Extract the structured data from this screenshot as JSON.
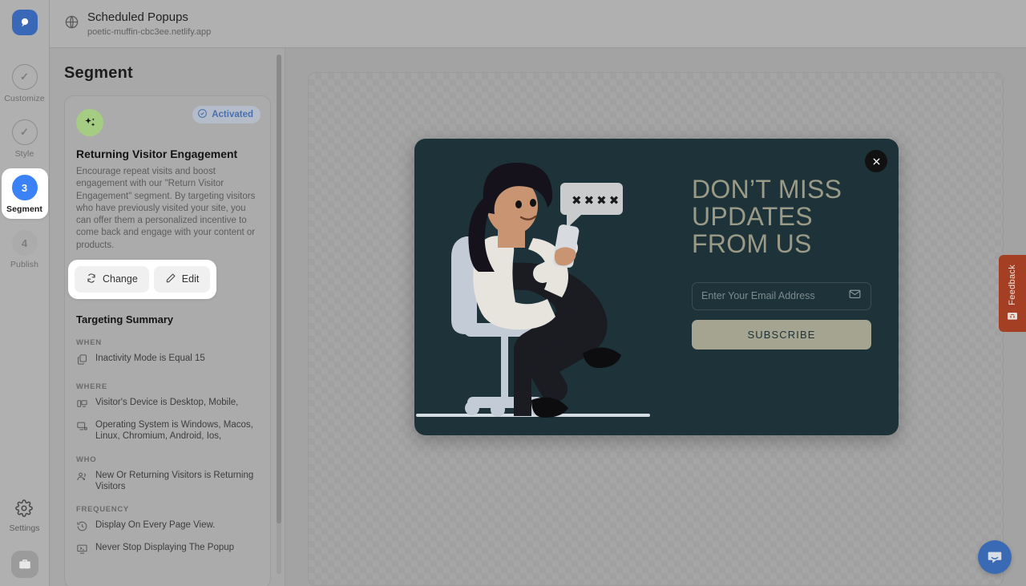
{
  "topbar": {
    "globe_icon": "globe-icon",
    "title": "Scheduled Popups",
    "subtitle": "poetic-muffin-cbc3ee.netlify.app"
  },
  "rail": {
    "logo_icon": "popupsmart-logo-icon",
    "steps": [
      {
        "label": "Customize",
        "mark": "✓",
        "state": "done"
      },
      {
        "label": "Style",
        "mark": "✓",
        "state": "done"
      },
      {
        "label": "Segment",
        "mark": "3",
        "state": "active"
      },
      {
        "label": "Publish",
        "mark": "4",
        "state": "idle"
      }
    ],
    "settings_label": "Settings",
    "settings_icon": "gear-icon",
    "briefcase_icon": "briefcase-icon"
  },
  "panel": {
    "title": "Segment",
    "badge": {
      "label": "Activated",
      "icon": "check-circle-icon"
    },
    "segment_icon": "sparkles-icon",
    "card_title": "Returning Visitor Engagement",
    "card_desc": "Encourage repeat visits and boost engagement with our \"Return Visitor Engagement\" segment. By targeting visitors who have previously visited your site, you can offer them a personalized incentive to come back and engage with your content or products.",
    "buttons": [
      {
        "label": "Change",
        "icon": "refresh-icon"
      },
      {
        "label": "Edit",
        "icon": "pencil-icon"
      }
    ],
    "summary_title": "Targeting Summary",
    "groups": [
      {
        "label": "WHEN",
        "rows": [
          {
            "icon": "copy-icon",
            "text": "Inactivity Mode is Equal 15"
          }
        ]
      },
      {
        "label": "WHERE",
        "rows": [
          {
            "icon": "device-icon",
            "text": "Visitor's Device is Desktop, Mobile,"
          },
          {
            "icon": "os-monitor-icon",
            "text": "Operating System is Windows, Macos, Linux, Chromium, Android, Ios,"
          }
        ]
      },
      {
        "label": "WHO",
        "rows": [
          {
            "icon": "users-icon",
            "text": "New Or Returning Visitors is Returning Visitors"
          }
        ]
      },
      {
        "label": "FREQUENCY",
        "rows": [
          {
            "icon": "clock-history-icon",
            "text": "Display On Every Page View."
          },
          {
            "icon": "monitor-arrow-icon",
            "text": "Never Stop Displaying The Popup"
          }
        ]
      }
    ]
  },
  "popup": {
    "close_icon": "close-icon",
    "headline": "DON’T MISS UPDATES FROM US",
    "email_placeholder": "Enter Your Email Address",
    "email_value": "",
    "email_icon": "envelope-icon",
    "subscribe_label": "SUBSCRIBE",
    "illustration": "woman-on-chair-with-phone-illustration",
    "bubble_dots": "✖✖✖✖",
    "colors": {
      "background": "#1d3239",
      "headline": "#9a9a87",
      "button": "#a4a491"
    }
  },
  "feedback": {
    "label": "Feedback",
    "icon": "feedback-face-icon"
  },
  "chat": {
    "icon": "chat-bubble-icon"
  }
}
